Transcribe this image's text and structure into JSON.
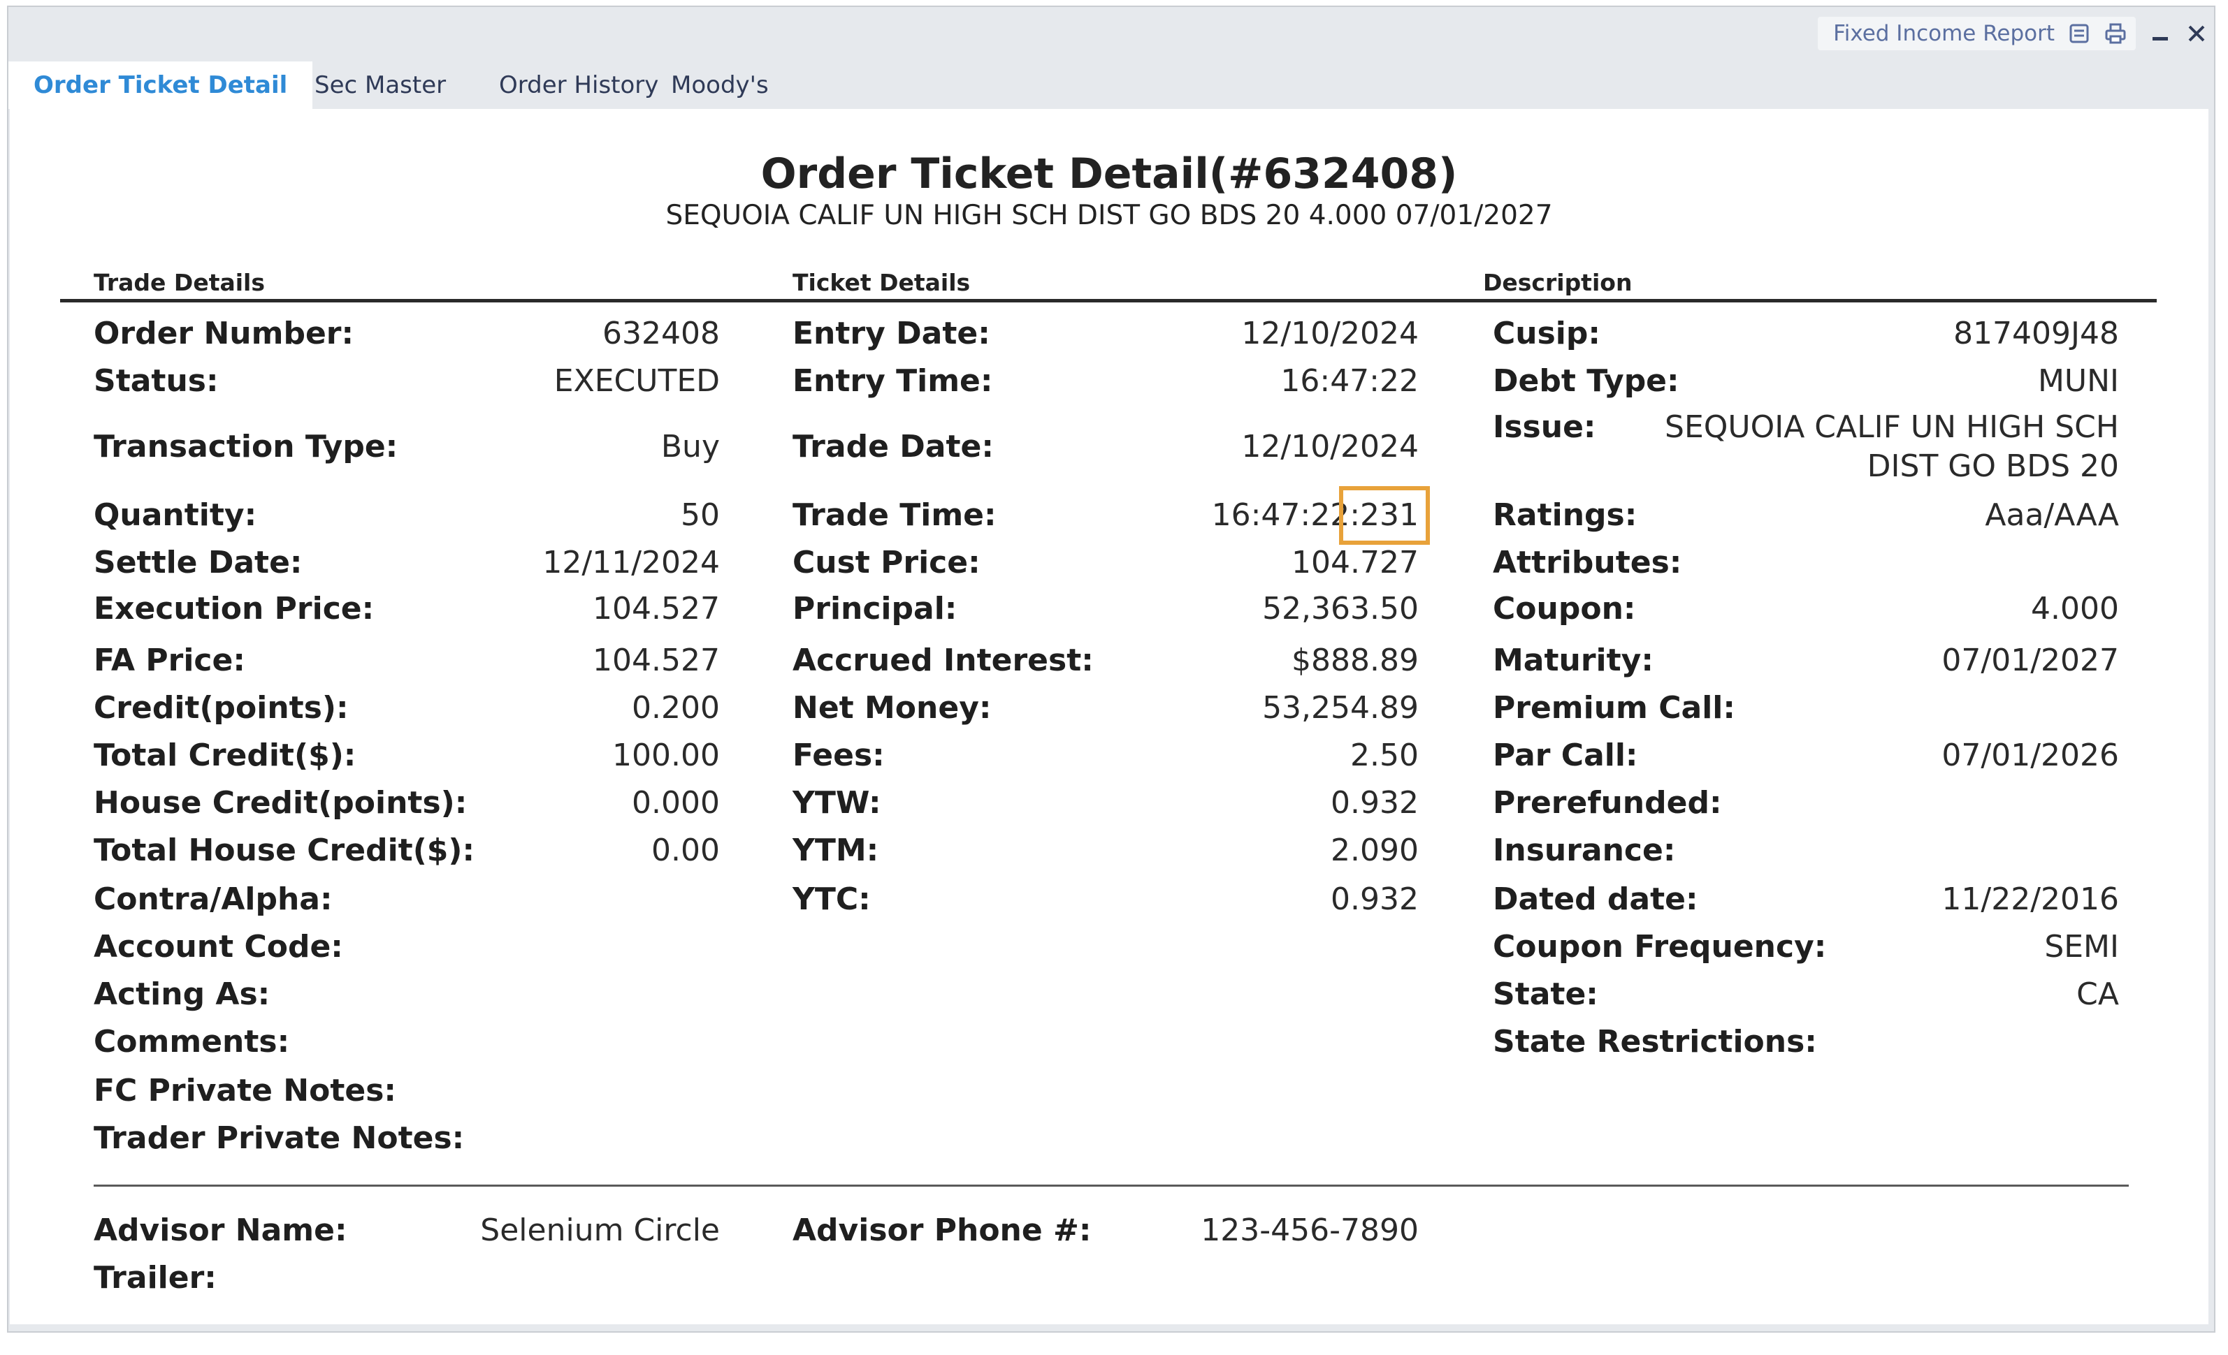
{
  "tabs": [
    {
      "label": "Order Ticket Detail",
      "active": true
    },
    {
      "label": "Sec Master",
      "active": false
    },
    {
      "label": "Order History",
      "active": false
    },
    {
      "label": "Moody's",
      "active": false
    }
  ],
  "toolbar": {
    "report_label": "Fixed Income Report",
    "icons": [
      "report-list-icon",
      "print-icon",
      "minimize-icon",
      "close-icon"
    ]
  },
  "header": {
    "title": "Order Ticket Detail(#632408)",
    "subtitle": "SEQUOIA CALIF UN HIGH SCH DIST GO BDS 20 4.000 07/01/2027"
  },
  "sections": {
    "trade": "Trade Details",
    "ticket": "Ticket Details",
    "description": "Description"
  },
  "trade_details": [
    {
      "label": "Order Number:",
      "value": "632408"
    },
    {
      "label": "Status:",
      "value": "EXECUTED"
    },
    {
      "label": "Transaction Type:",
      "value": "Buy"
    },
    {
      "label": "Quantity:",
      "value": "50"
    },
    {
      "label": "Settle Date:",
      "value": "12/11/2024"
    },
    {
      "label": "Execution Price:",
      "value": "104.527"
    },
    {
      "label": "FA Price:",
      "value": "104.527"
    },
    {
      "label": "Credit(points):",
      "value": "0.200"
    },
    {
      "label": "Total Credit($):",
      "value": "100.00"
    },
    {
      "label": "House Credit(points):",
      "value": "0.000"
    },
    {
      "label": "Total House Credit($):",
      "value": "0.00"
    },
    {
      "label": "Contra/Alpha:",
      "value": ""
    },
    {
      "label": "Account Code:",
      "value": ""
    },
    {
      "label": "Acting As:",
      "value": ""
    },
    {
      "label": "Comments:",
      "value": ""
    },
    {
      "label": "FC Private Notes:",
      "value": ""
    },
    {
      "label": "Trader Private Notes:",
      "value": ""
    }
  ],
  "ticket_details": [
    {
      "label": "Entry Date:",
      "value": "12/10/2024"
    },
    {
      "label": "Entry Time:",
      "value": "16:47:22"
    },
    {
      "label": "Trade Date:",
      "value": "12/10/2024"
    },
    {
      "label": "Trade Time:",
      "value": "16:47:22:231"
    },
    {
      "label": "Cust Price:",
      "value": "104.727"
    },
    {
      "label": "Principal:",
      "value": "52,363.50"
    },
    {
      "label": "Accrued Interest:",
      "value": "$888.89"
    },
    {
      "label": "Net Money:",
      "value": "53,254.89"
    },
    {
      "label": "Fees:",
      "value": "2.50"
    },
    {
      "label": "YTW:",
      "value": "0.932"
    },
    {
      "label": "YTM:",
      "value": "2.090"
    },
    {
      "label": "YTC:",
      "value": "0.932"
    }
  ],
  "description": [
    {
      "label": "Cusip:",
      "value": "817409J48"
    },
    {
      "label": "Debt Type:",
      "value": "MUNI"
    },
    {
      "label": "Issue:",
      "value_line1": "SEQUOIA CALIF UN HIGH SCH",
      "value_line2": "DIST GO BDS 20"
    },
    {
      "label": "Ratings:",
      "value": "Aaa/AAA"
    },
    {
      "label": "Attributes:",
      "value": ""
    },
    {
      "label": "Coupon:",
      "value": "4.000"
    },
    {
      "label": "Maturity:",
      "value": "07/01/2027"
    },
    {
      "label": "Premium Call:",
      "value": ""
    },
    {
      "label": "Par Call:",
      "value": "07/01/2026"
    },
    {
      "label": "Prerefunded:",
      "value": ""
    },
    {
      "label": "Insurance:",
      "value": ""
    },
    {
      "label": "Dated date:",
      "value": "11/22/2016"
    },
    {
      "label": "Coupon Frequency:",
      "value": "SEMI"
    },
    {
      "label": "State:",
      "value": "CA"
    },
    {
      "label": "State Restrictions:",
      "value": ""
    }
  ],
  "advisor": {
    "name_label": "Advisor Name:",
    "name_value": "Selenium Circle",
    "phone_label": "Advisor Phone #:",
    "phone_value": "123-456-7890",
    "trailer_label": "Trailer:",
    "trailer_value": ""
  },
  "colors": {
    "active_tab": "#2f8ad6",
    "tab_text": "#2f3a57",
    "highlight": "#e8a23a",
    "frame": "#e6e9ed"
  }
}
